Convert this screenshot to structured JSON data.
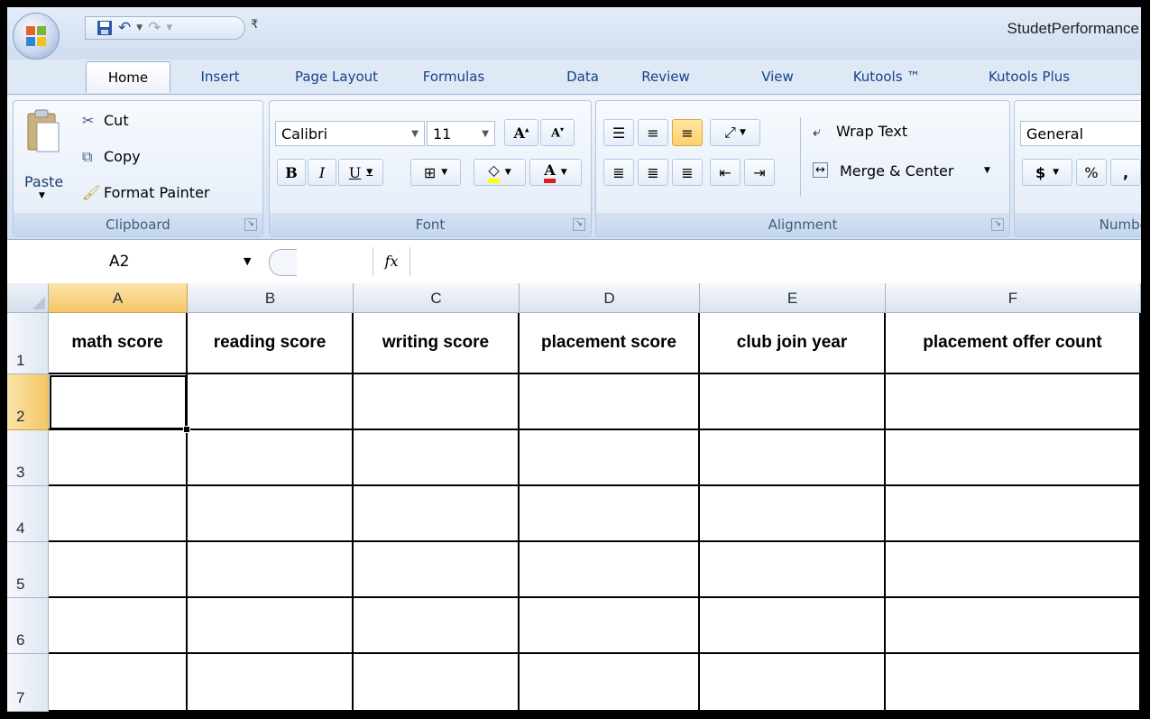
{
  "app": {
    "doc_title": "StudetPerformance",
    "quick_access": {
      "save_icon": "save-icon",
      "undo_icon": "undo-icon",
      "redo_icon": "redo-icon"
    }
  },
  "tabs": [
    "Home",
    "Insert",
    "Page Layout",
    "Formulas",
    "Data",
    "Review",
    "View",
    "Kutools ™",
    "Kutools Plus"
  ],
  "active_tab": "Home",
  "ribbon": {
    "clipboard": {
      "label": "Clipboard",
      "paste": "Paste",
      "cut": "Cut",
      "copy": "Copy",
      "format_painter": "Format Painter"
    },
    "font": {
      "label": "Font",
      "font_name": "Calibri",
      "font_size": "11",
      "bold": "B",
      "italic": "I",
      "underline": "U",
      "font_color_letter": "A"
    },
    "alignment": {
      "label": "Alignment",
      "wrap_text": "Wrap Text",
      "merge_center": "Merge & Center"
    },
    "number": {
      "label": "Number",
      "format": "General",
      "currency": "$",
      "percent": "%",
      "comma": ","
    }
  },
  "formula_bar": {
    "name_box": "A2",
    "fx": "fx",
    "formula": ""
  },
  "sheet": {
    "columns": [
      "A",
      "B",
      "C",
      "D",
      "E",
      "F"
    ],
    "rows": [
      "1",
      "2",
      "3",
      "4",
      "5",
      "6",
      "7"
    ],
    "headers": [
      "math score",
      "reading score",
      "writing score",
      "placement score",
      "club join year",
      "placement offer count"
    ],
    "selected_cell": "A2"
  },
  "colors": {
    "selection_header": "#f4c766",
    "ribbon_text": "#15428b"
  }
}
